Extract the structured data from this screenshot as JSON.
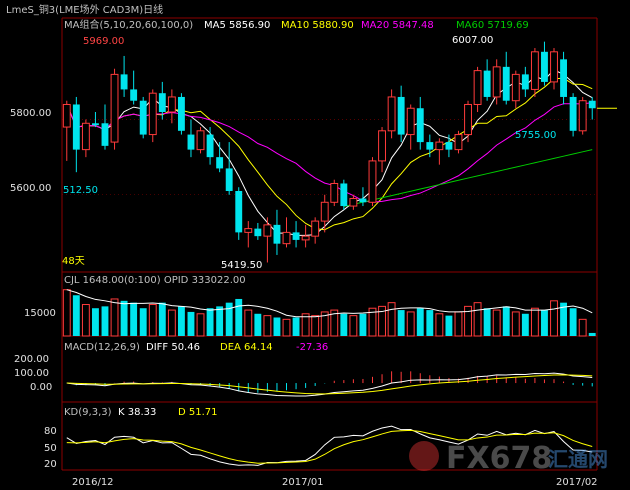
{
  "window": {
    "title": "LmeS_铜3(LME场外 CAD3M)日线"
  },
  "colors": {
    "bg": "#000000",
    "grid": "#8b0000",
    "up": "#ff3b3b",
    "down": "#00e5ee",
    "ma5": "#ffffff",
    "ma10": "#ffff00",
    "ma20": "#ff00ff",
    "ma60": "#00cc00",
    "text": "#c0c0c0",
    "price_label": "#e0e0e0"
  },
  "price_panel": {
    "header": "MA组合(5,10,20,60,100,0)",
    "legend": [
      {
        "label": "MA5 5856.90",
        "color": "#ffffff"
      },
      {
        "label": "MA10 5880.90",
        "color": "#ffff00"
      },
      {
        "label": "MA20 5847.48",
        "color": "#ff00ff"
      },
      {
        "label": "MA60 5719.69",
        "color": "#00cc00"
      }
    ],
    "y_ticks": [
      "5800.00",
      "5600.00"
    ],
    "annotations": {
      "high_left": "5969.00",
      "high_right": "6007.00",
      "low_mid": "5419.50",
      "low_left": "512.50",
      "right_low": "5755.00",
      "days": "48天"
    }
  },
  "volume_panel": {
    "header": "CJL  1648.00(0:100)  OPID  333022.00",
    "y_tick": "15000"
  },
  "macd_panel": {
    "header": "MACD(12,26,9)",
    "diff": "DIFF  50.46",
    "dea": "DEA  64.14",
    "macd": "-27.36",
    "y_ticks": [
      "200.00",
      "100.00",
      "0.00"
    ]
  },
  "kd_panel": {
    "header": "KD(9,3,3)",
    "k": "K  38.33",
    "d": "D  51.71",
    "y_ticks": [
      "80",
      "50",
      "20"
    ]
  },
  "x_axis": {
    "labels": [
      "2016/12",
      "2017/01",
      "2017/02"
    ]
  },
  "watermark": {
    "text": "FX678",
    "sub": "汇通网"
  },
  "chart_data": {
    "type": "candlestick",
    "title": "LmeS_铜3(LME场外 CAD3M)日线",
    "ylim": [
      5400,
      6030
    ],
    "candles": [
      {
        "o": 5780,
        "h": 5850,
        "l": 5690,
        "c": 5840
      },
      {
        "o": 5840,
        "h": 5860,
        "l": 5660,
        "c": 5720
      },
      {
        "o": 5720,
        "h": 5800,
        "l": 5700,
        "c": 5790
      },
      {
        "o": 5790,
        "h": 5820,
        "l": 5780,
        "c": 5785
      },
      {
        "o": 5790,
        "h": 5840,
        "l": 5720,
        "c": 5730
      },
      {
        "o": 5740,
        "h": 5935,
        "l": 5720,
        "c": 5920
      },
      {
        "o": 5920,
        "h": 5969,
        "l": 5860,
        "c": 5880
      },
      {
        "o": 5880,
        "h": 5930,
        "l": 5840,
        "c": 5850
      },
      {
        "o": 5850,
        "h": 5860,
        "l": 5750,
        "c": 5760
      },
      {
        "o": 5760,
        "h": 5880,
        "l": 5740,
        "c": 5870
      },
      {
        "o": 5870,
        "h": 5900,
        "l": 5800,
        "c": 5820
      },
      {
        "o": 5820,
        "h": 5880,
        "l": 5790,
        "c": 5860
      },
      {
        "o": 5860,
        "h": 5870,
        "l": 5760,
        "c": 5770
      },
      {
        "o": 5760,
        "h": 5800,
        "l": 5700,
        "c": 5720
      },
      {
        "o": 5720,
        "h": 5780,
        "l": 5710,
        "c": 5770
      },
      {
        "o": 5760,
        "h": 5780,
        "l": 5680,
        "c": 5700
      },
      {
        "o": 5700,
        "h": 5740,
        "l": 5660,
        "c": 5670
      },
      {
        "o": 5670,
        "h": 5740,
        "l": 5600,
        "c": 5610
      },
      {
        "o": 5610,
        "h": 5620,
        "l": 5480,
        "c": 5500
      },
      {
        "o": 5500,
        "h": 5530,
        "l": 5460,
        "c": 5510
      },
      {
        "o": 5510,
        "h": 5525,
        "l": 5480,
        "c": 5490
      },
      {
        "o": 5490,
        "h": 5540,
        "l": 5420,
        "c": 5520
      },
      {
        "o": 5520,
        "h": 5560,
        "l": 5440,
        "c": 5470
      },
      {
        "o": 5470,
        "h": 5540,
        "l": 5460,
        "c": 5500
      },
      {
        "o": 5500,
        "h": 5530,
        "l": 5460,
        "c": 5480
      },
      {
        "o": 5480,
        "h": 5520,
        "l": 5460,
        "c": 5490
      },
      {
        "o": 5490,
        "h": 5540,
        "l": 5470,
        "c": 5530
      },
      {
        "o": 5530,
        "h": 5600,
        "l": 5500,
        "c": 5580
      },
      {
        "o": 5580,
        "h": 5640,
        "l": 5570,
        "c": 5630
      },
      {
        "o": 5630,
        "h": 5640,
        "l": 5560,
        "c": 5570
      },
      {
        "o": 5570,
        "h": 5600,
        "l": 5560,
        "c": 5590
      },
      {
        "o": 5590,
        "h": 5620,
        "l": 5570,
        "c": 5580
      },
      {
        "o": 5580,
        "h": 5700,
        "l": 5570,
        "c": 5690
      },
      {
        "o": 5690,
        "h": 5780,
        "l": 5660,
        "c": 5770
      },
      {
        "o": 5770,
        "h": 5880,
        "l": 5750,
        "c": 5860
      },
      {
        "o": 5860,
        "h": 5890,
        "l": 5740,
        "c": 5760
      },
      {
        "o": 5760,
        "h": 5840,
        "l": 5720,
        "c": 5830
      },
      {
        "o": 5830,
        "h": 5860,
        "l": 5720,
        "c": 5740
      },
      {
        "o": 5740,
        "h": 5760,
        "l": 5700,
        "c": 5720
      },
      {
        "o": 5720,
        "h": 5750,
        "l": 5680,
        "c": 5740
      },
      {
        "o": 5740,
        "h": 5760,
        "l": 5700,
        "c": 5720
      },
      {
        "o": 5720,
        "h": 5770,
        "l": 5710,
        "c": 5760
      },
      {
        "o": 5760,
        "h": 5850,
        "l": 5740,
        "c": 5840
      },
      {
        "o": 5840,
        "h": 5940,
        "l": 5820,
        "c": 5930
      },
      {
        "o": 5930,
        "h": 5960,
        "l": 5850,
        "c": 5860
      },
      {
        "o": 5860,
        "h": 5960,
        "l": 5840,
        "c": 5940
      },
      {
        "o": 5940,
        "h": 5980,
        "l": 5840,
        "c": 5850
      },
      {
        "o": 5850,
        "h": 5930,
        "l": 5830,
        "c": 5920
      },
      {
        "o": 5920,
        "h": 5940,
        "l": 5860,
        "c": 5880
      },
      {
        "o": 5880,
        "h": 5990,
        "l": 5860,
        "c": 5980
      },
      {
        "o": 5980,
        "h": 6007,
        "l": 5890,
        "c": 5900
      },
      {
        "o": 5900,
        "h": 5990,
        "l": 5880,
        "c": 5980
      },
      {
        "o": 5960,
        "h": 5980,
        "l": 5840,
        "c": 5860
      },
      {
        "o": 5860,
        "h": 5870,
        "l": 5755,
        "c": 5770
      },
      {
        "o": 5770,
        "h": 5860,
        "l": 5760,
        "c": 5850
      },
      {
        "o": 5850,
        "h": 5860,
        "l": 5800,
        "c": 5830
      }
    ],
    "volume": [
      25000,
      22000,
      17000,
      15000,
      16000,
      20000,
      19000,
      18000,
      15000,
      17000,
      18000,
      14000,
      16000,
      13000,
      12000,
      15000,
      16000,
      18000,
      20000,
      14000,
      12000,
      11000,
      10000,
      9000,
      10000,
      12000,
      11000,
      13000,
      14000,
      12000,
      11000,
      12000,
      15000,
      16000,
      18000,
      14000,
      13000,
      15000,
      14000,
      12000,
      11000,
      13000,
      16000,
      18000,
      15000,
      14000,
      16000,
      13000,
      12000,
      15000,
      14000,
      19000,
      18000,
      15000,
      9000,
      1648
    ],
    "x_labels": [
      "2016/12",
      "2017/01",
      "2017/02"
    ]
  }
}
